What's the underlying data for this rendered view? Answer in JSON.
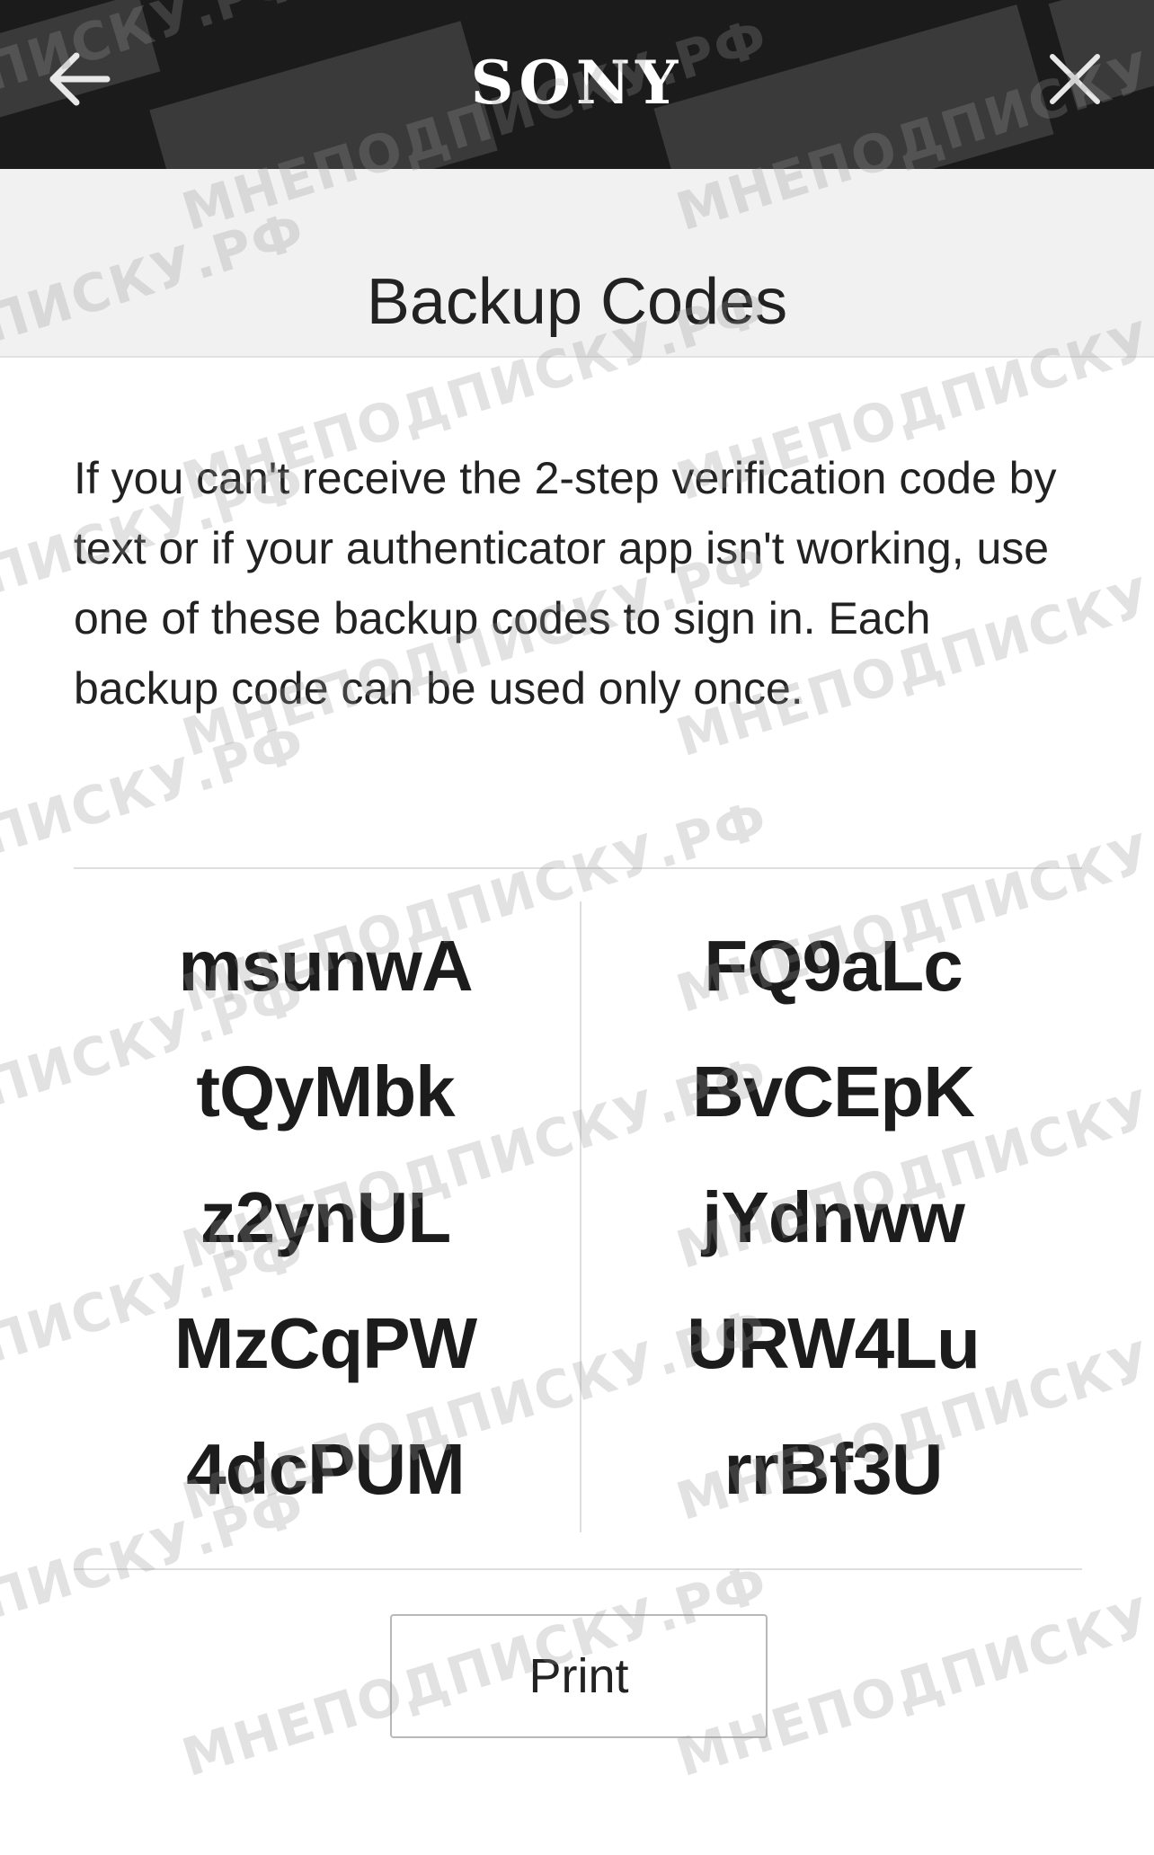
{
  "header": {
    "brand": "SONY",
    "back_icon": "arrow-left-icon",
    "close_icon": "close-icon"
  },
  "page": {
    "title": "Backup Codes",
    "description": "If you can't receive the 2-step verification code by text or if your authenticator app isn't working, use one of these backup codes to sign in. Each backup code can be used only once."
  },
  "codes": {
    "left": [
      "msunwA",
      "tQyMbk",
      "z2ynUL",
      "MzCqPW",
      "4dcPUM"
    ],
    "right": [
      "FQ9aLc",
      "BvCEpK",
      "jYdnww",
      "URW4Lu",
      "rrBf3U"
    ]
  },
  "actions": {
    "print_label": "Print"
  },
  "watermark": {
    "text": "МНЕПОДПИСКУ.РФ"
  },
  "colors": {
    "header_bg": "#1b1b1b",
    "title_bar_bg": "#f1f1f1",
    "text": "#222222"
  }
}
